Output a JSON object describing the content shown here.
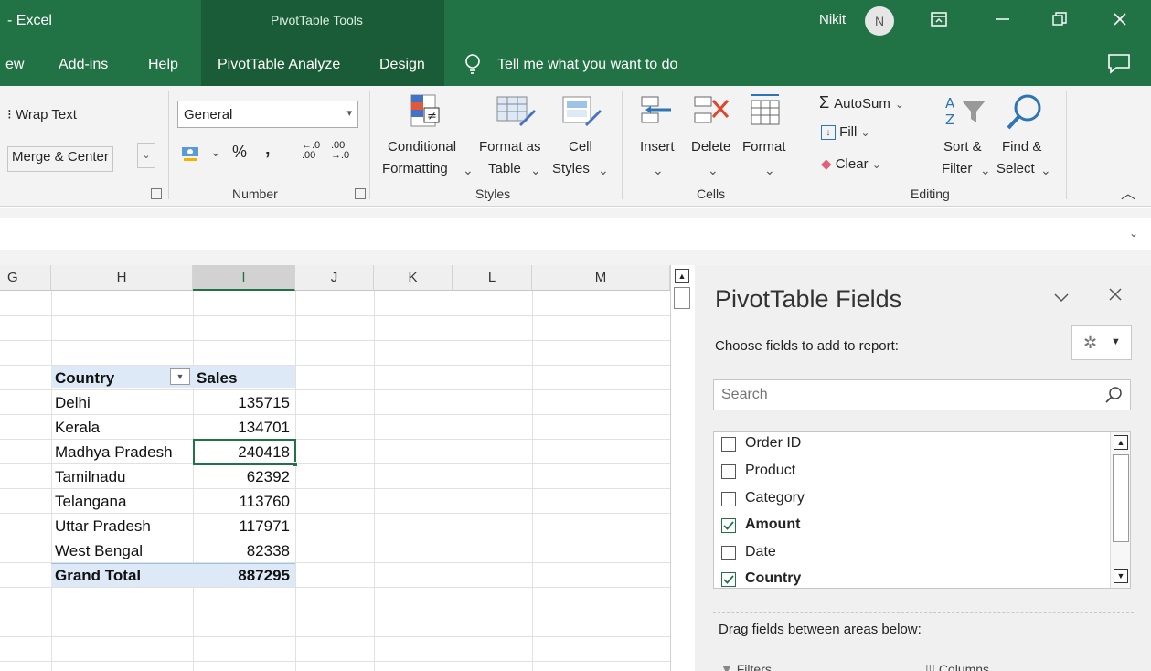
{
  "title_bar": {
    "app_title": "- Excel",
    "context_title": "PivotTable Tools",
    "user_name": "Nikit",
    "avatar_initial": "N"
  },
  "tabs": {
    "items": [
      "ew",
      "Add-ins",
      "Help",
      "PivotTable Analyze",
      "Design"
    ],
    "tell_me": "Tell me what you want to do"
  },
  "ribbon": {
    "alignment": {
      "wrap_text": "Wrap Text",
      "merge_center": "Merge & Center"
    },
    "number": {
      "format_value": "General",
      "percent": "%",
      "comma": ",",
      "group_label": "Number"
    },
    "styles": {
      "conditional_1": "Conditional",
      "conditional_2": "Formatting",
      "format_as_1": "Format as",
      "format_as_2": "Table",
      "cell_styles_1": "Cell",
      "cell_styles_2": "Styles",
      "group_label": "Styles"
    },
    "cells": {
      "insert": "Insert",
      "delete": "Delete",
      "format": "Format",
      "group_label": "Cells"
    },
    "editing": {
      "autosum": "AutoSum",
      "fill": "Fill",
      "clear": "Clear",
      "sort_1": "Sort &",
      "sort_2": "Filter",
      "find_1": "Find &",
      "find_2": "Select",
      "group_label": "Editing"
    }
  },
  "columns": [
    "G",
    "H",
    "I",
    "J",
    "K",
    "L",
    "M"
  ],
  "pivot": {
    "header_country": "Country",
    "header_sales": "Sales",
    "rows": [
      {
        "country": "Delhi",
        "sales": "135715"
      },
      {
        "country": "Kerala",
        "sales": "134701"
      },
      {
        "country": "Madhya Pradesh",
        "sales": "240418"
      },
      {
        "country": "Tamilnadu",
        "sales": "62392"
      },
      {
        "country": "Telangana",
        "sales": "113760"
      },
      {
        "country": "Uttar Pradesh",
        "sales": "117971"
      },
      {
        "country": "West Bengal",
        "sales": "82338"
      }
    ],
    "total_label": "Grand Total",
    "total_value": "887295"
  },
  "pane": {
    "title": "PivotTable Fields",
    "choose_label": "Choose fields to add to report:",
    "search_placeholder": "Search",
    "fields": [
      {
        "name": "Order ID",
        "checked": false
      },
      {
        "name": "Product",
        "checked": false
      },
      {
        "name": "Category",
        "checked": false
      },
      {
        "name": "Amount",
        "checked": true
      },
      {
        "name": "Date",
        "checked": false
      },
      {
        "name": "Country",
        "checked": true
      }
    ],
    "drag_label": "Drag fields between areas below:",
    "area_filters": "Filters",
    "area_columns": "Columns"
  },
  "colors": {
    "excel_green": "#217346",
    "pivot_header": "#dde9f6"
  }
}
